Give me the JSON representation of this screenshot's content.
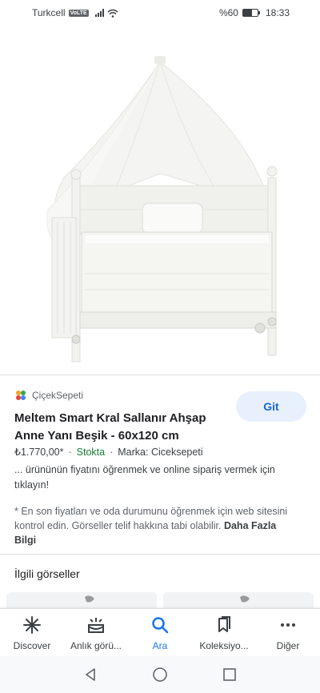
{
  "status_bar": {
    "carrier": "Turkcell",
    "network_badge": "VoLTE",
    "battery_text": "%60",
    "battery_level": 0.6,
    "time": "18:33"
  },
  "result": {
    "source_name": "ÇiçekSepeti",
    "go_label": "Git",
    "title": "Meltem Smart Kral Sallanır Ahşap Anne Yanı Beşik - 60x120 cm",
    "price": "₺1.770,00*",
    "stock": "Stokta",
    "brand": "Marka: Ciceksepeti",
    "description": "... ürününün fiyatını öğrenmek ve online sipariş vermek için tıklayın!",
    "note": "* En son fiyatları ve oda durumunu öğrenmek için web sitesini kontrol edin. Görseller telif hakkına tabi olabilir.",
    "more_info": "Daha Fazla Bilgi"
  },
  "related": {
    "title": "İlgili görseller"
  },
  "bottom_nav": {
    "items": [
      {
        "label": "Discover",
        "icon": "asterisk-icon"
      },
      {
        "label": "Anlık görü...",
        "icon": "updates-icon"
      },
      {
        "label": "Ara",
        "icon": "search-icon"
      },
      {
        "label": "Koleksiyo...",
        "icon": "collections-icon"
      },
      {
        "label": "Diğer",
        "icon": "more-icon"
      }
    ],
    "active_index": 2
  },
  "colors": {
    "accent": "#1a73e8",
    "stock_green": "#188038",
    "go_button_bg": "#e8f0fe"
  }
}
